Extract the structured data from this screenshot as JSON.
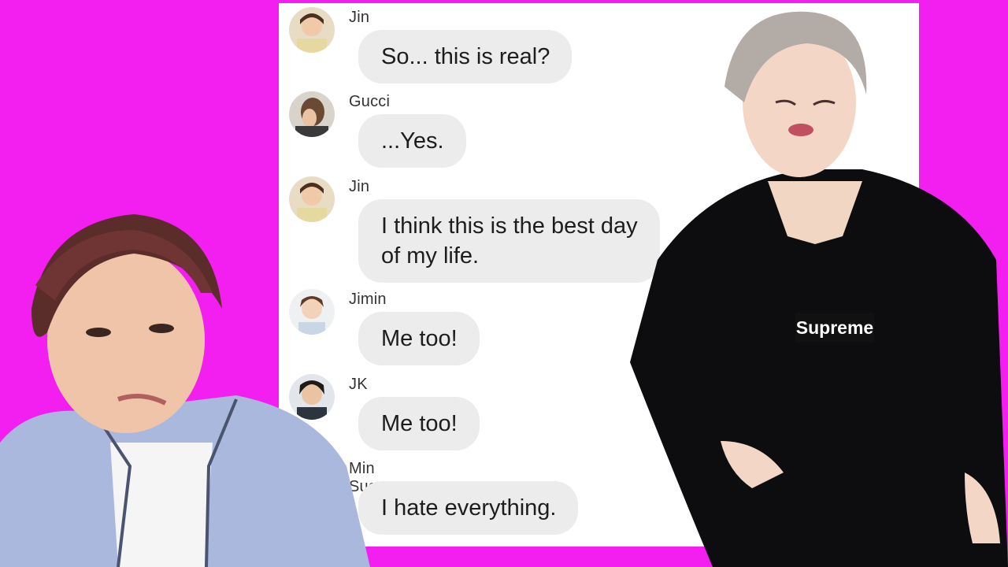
{
  "colors": {
    "background": "#f21ff0",
    "bubble": "#ececec",
    "panel": "#ffffff"
  },
  "messages": [
    {
      "sender": "Jin",
      "lines": [
        "So... this is real?"
      ],
      "avatar": "jin-avatar"
    },
    {
      "sender": "Gucci",
      "lines": [
        "...Yes."
      ],
      "avatar": "gucci-avatar"
    },
    {
      "sender": "Jin",
      "lines": [
        "I think this is the best day",
        "of my life."
      ],
      "avatar": "jin-avatar"
    },
    {
      "sender": "Jimin",
      "lines": [
        "Me too!"
      ],
      "avatar": "jimin-avatar"
    },
    {
      "sender": "JK",
      "lines": [
        "Me too!"
      ],
      "avatar": "jk-avatar"
    },
    {
      "sender": "Min Suga",
      "lines": [
        "I hate everything."
      ],
      "avatar": null
    }
  ],
  "overlay": {
    "shirt_logo": "Supreme"
  }
}
